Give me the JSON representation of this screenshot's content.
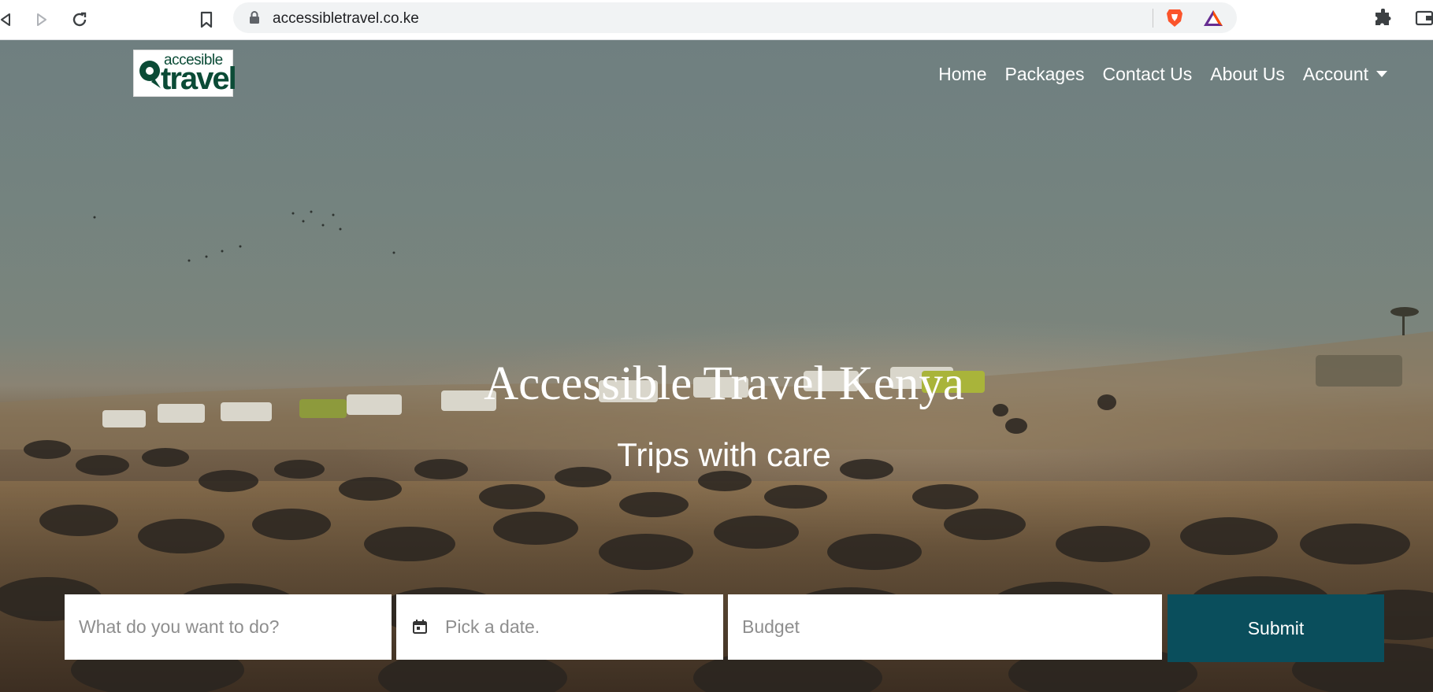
{
  "browser": {
    "url": "accessibletravel.co.ke",
    "icons": [
      "back-icon",
      "forward-icon",
      "reload-icon",
      "bookmark-icon",
      "lock-icon",
      "brave-shields-icon",
      "brave-rewards-icon",
      "extensions-icon",
      "wallet-icon"
    ]
  },
  "site": {
    "logo": {
      "small": "accesible",
      "big": "travel"
    },
    "nav": {
      "home": "Home",
      "packages": "Packages",
      "contact": "Contact Us",
      "about": "About Us",
      "account": "Account"
    },
    "hero": {
      "title": "Accessible Travel Kenya",
      "subtitle": "Trips with care"
    },
    "search": {
      "activity_placeholder": "What do you want to do?",
      "date_placeholder": "Pick a date.",
      "budget_placeholder": "Budget",
      "submit_label": "Submit"
    },
    "colors": {
      "brand_green": "#0b4b36",
      "submit_teal": "#0a4e5c"
    }
  }
}
